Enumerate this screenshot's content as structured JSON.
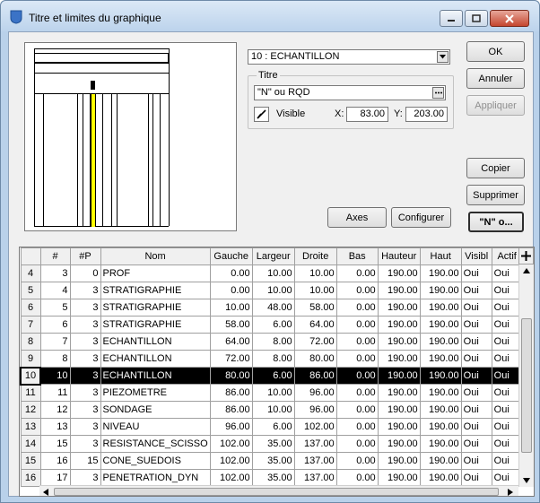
{
  "window": {
    "title": "Titre et limites du graphique",
    "minimize_icon": "minimize-icon",
    "maximize_icon": "maximize-icon",
    "close_icon": "close-icon"
  },
  "element_select": {
    "value": "10 : ECHANTILLON"
  },
  "titre_group": {
    "label": "Titre",
    "text_value": "\"N\" ou RQD",
    "visible_label": "Visible",
    "visible_checked": true,
    "x_label": "X:",
    "x_value": "83.00",
    "y_label": "Y:",
    "y_value": "203.00"
  },
  "buttons": {
    "ok": "OK",
    "annuler": "Annuler",
    "appliquer": "Appliquer",
    "copier": "Copier",
    "supprimer": "Supprimer",
    "n_o": "\"N\" o...",
    "axes": "Axes",
    "configurer": "Configurer"
  },
  "table": {
    "columns": [
      "#",
      "#P",
      "Nom",
      "Gauche",
      "Largeur",
      "Droite",
      "Bas",
      "Hauteur",
      "Haut",
      "Visibl",
      "Actif"
    ],
    "add_column_icon": "plus-icon",
    "selected_row_number": "10",
    "rows": [
      [
        "4",
        "3",
        "0",
        "PROF",
        "0.00",
        "10.00",
        "10.00",
        "0.00",
        "190.00",
        "190.00",
        "Oui",
        "Oui"
      ],
      [
        "5",
        "4",
        "3",
        "STRATIGRAPHIE",
        "0.00",
        "10.00",
        "10.00",
        "0.00",
        "190.00",
        "190.00",
        "Oui",
        "Oui"
      ],
      [
        "6",
        "5",
        "3",
        "STRATIGRAPHIE",
        "10.00",
        "48.00",
        "58.00",
        "0.00",
        "190.00",
        "190.00",
        "Oui",
        "Oui"
      ],
      [
        "7",
        "6",
        "3",
        "STRATIGRAPHIE",
        "58.00",
        "6.00",
        "64.00",
        "0.00",
        "190.00",
        "190.00",
        "Oui",
        "Oui"
      ],
      [
        "8",
        "7",
        "3",
        "ECHANTILLON",
        "64.00",
        "8.00",
        "72.00",
        "0.00",
        "190.00",
        "190.00",
        "Oui",
        "Oui"
      ],
      [
        "9",
        "8",
        "3",
        "ECHANTILLON",
        "72.00",
        "8.00",
        "80.00",
        "0.00",
        "190.00",
        "190.00",
        "Oui",
        "Oui"
      ],
      [
        "10",
        "10",
        "3",
        "ECHANTILLON",
        "80.00",
        "6.00",
        "86.00",
        "0.00",
        "190.00",
        "190.00",
        "Oui",
        "Oui"
      ],
      [
        "11",
        "11",
        "3",
        "PIEZOMETRE",
        "86.00",
        "10.00",
        "96.00",
        "0.00",
        "190.00",
        "190.00",
        "Oui",
        "Oui"
      ],
      [
        "12",
        "12",
        "3",
        "SONDAGE",
        "86.00",
        "10.00",
        "96.00",
        "0.00",
        "190.00",
        "190.00",
        "Oui",
        "Oui"
      ],
      [
        "13",
        "13",
        "3",
        "NIVEAU",
        "96.00",
        "6.00",
        "102.00",
        "0.00",
        "190.00",
        "190.00",
        "Oui",
        "Oui"
      ],
      [
        "14",
        "15",
        "3",
        "RESISTANCE_SCISSO",
        "102.00",
        "35.00",
        "137.00",
        "0.00",
        "190.00",
        "190.00",
        "Oui",
        "Oui"
      ],
      [
        "15",
        "16",
        "15",
        "CONE_SUEDOIS",
        "102.00",
        "35.00",
        "137.00",
        "0.00",
        "190.00",
        "190.00",
        "Oui",
        "Oui"
      ],
      [
        "16",
        "17",
        "3",
        "PENETRATION_DYN",
        "102.00",
        "35.00",
        "137.00",
        "0.00",
        "190.00",
        "190.00",
        "Oui",
        "Oui"
      ]
    ]
  },
  "colors": {
    "highlight_column": "#ffff00",
    "selected_row_bg": "#000000",
    "selected_row_text": "#ffffff"
  }
}
